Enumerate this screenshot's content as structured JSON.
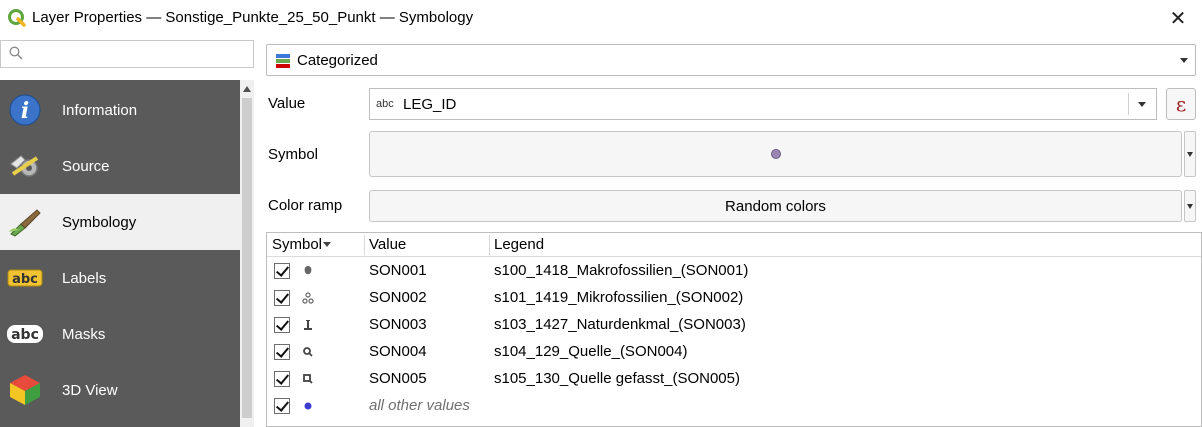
{
  "window": {
    "title": "Layer Properties — Sonstige_Punkte_25_50_Punkt — Symbology",
    "close_glyph": "✕"
  },
  "search": {
    "placeholder": "",
    "value": ""
  },
  "sidebar": {
    "items": [
      {
        "label": "Information",
        "icon": "information-icon",
        "active": false
      },
      {
        "label": "Source",
        "icon": "source-icon",
        "active": false
      },
      {
        "label": "Symbology",
        "icon": "symbology-icon",
        "active": true
      },
      {
        "label": "Labels",
        "icon": "labels-icon",
        "active": false
      },
      {
        "label": "Masks",
        "icon": "masks-icon",
        "active": false
      },
      {
        "label": "3D View",
        "icon": "3d-view-icon",
        "active": false
      }
    ]
  },
  "renderer": {
    "selected": "Categorized",
    "icon": "categorized-icon"
  },
  "form": {
    "value_label": "Value",
    "value_type_tag": "abc",
    "value_field": "LEG_ID",
    "expression_glyph": "ε",
    "symbol_label": "Symbol",
    "symbol_color": "#9a86b5",
    "color_ramp_label": "Color ramp",
    "color_ramp_value": "Random colors"
  },
  "table": {
    "headers": {
      "symbol": "Symbol",
      "value": "Value",
      "legend": "Legend"
    },
    "rows": [
      {
        "checked": true,
        "symbol_icon": "fossil-marker-icon",
        "value": "SON001",
        "legend": "s100_1418_Makrofossilien_(SON001)"
      },
      {
        "checked": true,
        "symbol_icon": "microfossil-marker-icon",
        "value": "SON002",
        "legend": "s101_1419_Mikrofossilien_(SON002)"
      },
      {
        "checked": true,
        "symbol_icon": "monument-marker-icon",
        "value": "SON003",
        "legend": "s103_1427_Naturdenkmal_(SON003)"
      },
      {
        "checked": true,
        "symbol_icon": "spring-marker-icon",
        "value": "SON004",
        "legend": "s104_129_Quelle_(SON004)"
      },
      {
        "checked": true,
        "symbol_icon": "captured-spring-marker-icon",
        "value": "SON005",
        "legend": "s105_130_Quelle gefasst_(SON005)"
      },
      {
        "checked": true,
        "symbol_icon": "dot-marker-icon",
        "value": "all other values",
        "legend": "",
        "other": true,
        "dot_color": "#3c3ccf"
      }
    ]
  }
}
